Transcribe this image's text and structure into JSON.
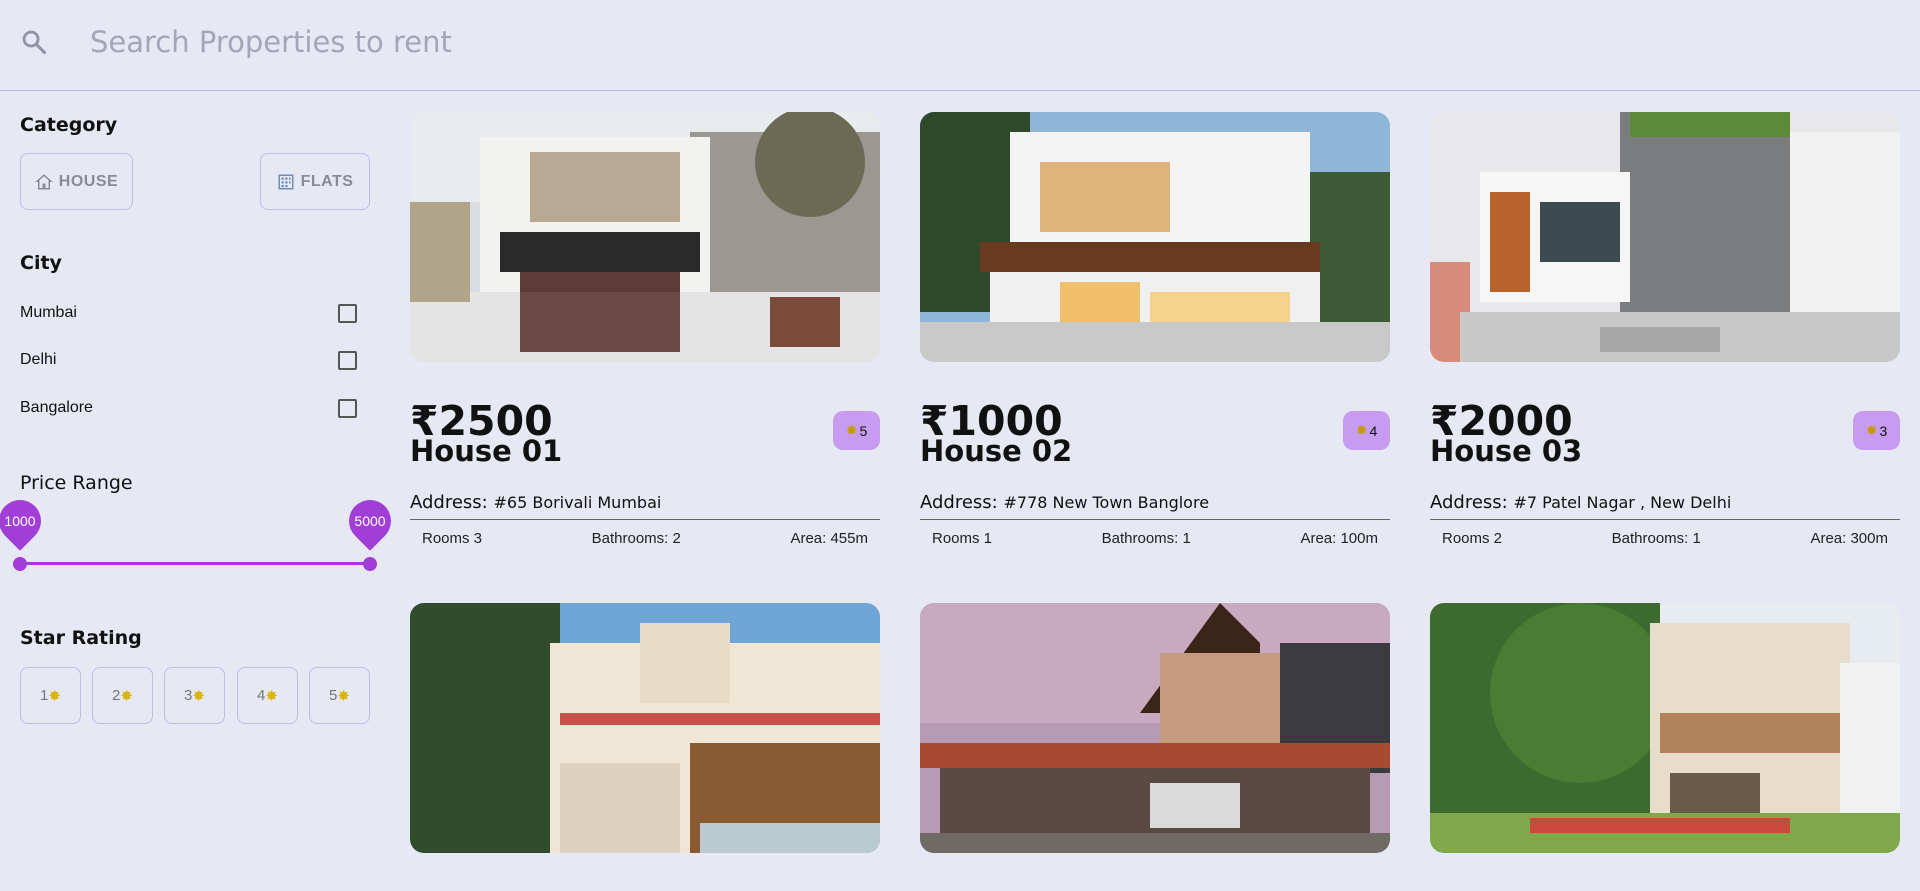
{
  "search": {
    "placeholder": "Search Properties to rent"
  },
  "filters": {
    "category": {
      "title": "Category",
      "house_label": "HOUSE",
      "flats_label": "FLATS"
    },
    "city": {
      "title": "City",
      "options": [
        "Mumbai",
        "Delhi",
        "Bangalore"
      ]
    },
    "price_range": {
      "title": "Price Range",
      "min": "1000",
      "max": "5000"
    },
    "star_rating": {
      "title": "Star Rating",
      "options": [
        "1",
        "2",
        "3",
        "4",
        "5"
      ]
    }
  },
  "labels": {
    "address": "Address:"
  },
  "listings": [
    {
      "price": "₹2500",
      "rating": "5",
      "name": "House 01",
      "address": "#65 Borivali Mumbai",
      "rooms": "Rooms 3",
      "bathrooms": "Bathrooms: 2",
      "area": "Area: 455m"
    },
    {
      "price": "₹1000",
      "rating": "4",
      "name": "House 02",
      "address": "#778 New Town Banglore",
      "rooms": "Rooms 1",
      "bathrooms": "Bathrooms: 1",
      "area": "Area: 100m"
    },
    {
      "price": "₹2000",
      "rating": "3",
      "name": "House 03",
      "address": "#7 Patel Nagar , New Delhi",
      "rooms": "Rooms 2",
      "bathrooms": "Bathrooms: 1",
      "area": "Area: 300m"
    }
  ],
  "colors": {
    "background": "#e6e8f4",
    "accent": "#a13ed8",
    "badge": "#c79bf0",
    "border": "#c5b8ec"
  }
}
